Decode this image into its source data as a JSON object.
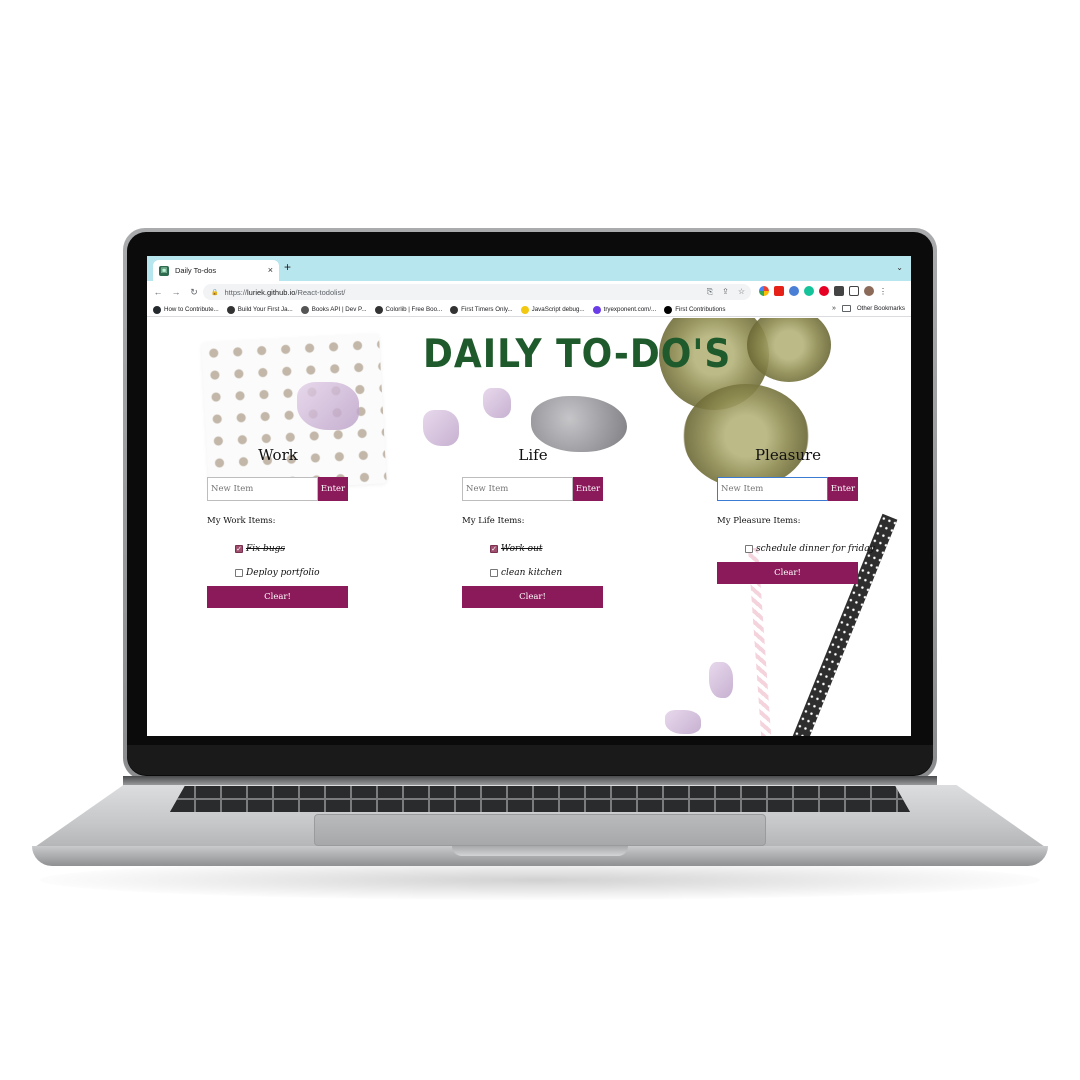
{
  "browser": {
    "tab_title": "Daily To-dos",
    "tab_close": "×",
    "new_tab": "+",
    "tab_menu": "⌄",
    "url_scheme": "https://",
    "url_host": "luriek.github.io",
    "url_path": "/React-todolist/",
    "bookmarks": [
      {
        "label": "How to Contribute...",
        "color": "#24292e"
      },
      {
        "label": "Build Your First Ja...",
        "color": "#333333"
      },
      {
        "label": "Books API | Dev P...",
        "color": "#555555"
      },
      {
        "label": "Colorlib | Free Boo...",
        "color": "#333333"
      },
      {
        "label": "First Timers Only...",
        "color": "#333333"
      },
      {
        "label": "JavaScript debug...",
        "color": "#f2c811"
      },
      {
        "label": "tryexponent.com/...",
        "color": "#6a3de8"
      },
      {
        "label": "First Contributions",
        "color": "#000000"
      }
    ],
    "bookmarks_overflow": "»",
    "other_bookmarks": "Other Bookmarks"
  },
  "app": {
    "title": "DAILY TO-DO'S",
    "accent_color": "#8b1a5a",
    "title_color": "#1e5a2c",
    "columns": [
      {
        "heading": "Work",
        "placeholder": "New Item",
        "enter_label": "Enter",
        "items_label": "My Work Items:",
        "items": [
          {
            "text": "Fix bugs",
            "done": true
          },
          {
            "text": "Deploy portfolio",
            "done": false
          }
        ],
        "clear_label": "Clear!"
      },
      {
        "heading": "Life",
        "placeholder": "New Item",
        "enter_label": "Enter",
        "items_label": "My Life Items:",
        "items": [
          {
            "text": "Work out",
            "done": true
          },
          {
            "text": "clean kitchen",
            "done": false
          }
        ],
        "clear_label": "Clear!"
      },
      {
        "heading": "Pleasure",
        "placeholder": "New Item",
        "enter_label": "Enter",
        "items_label": "My Pleasure Items:",
        "items": [
          {
            "text": "schedule dinner for friday",
            "done": false
          }
        ],
        "clear_label": "Clear!"
      }
    ]
  }
}
